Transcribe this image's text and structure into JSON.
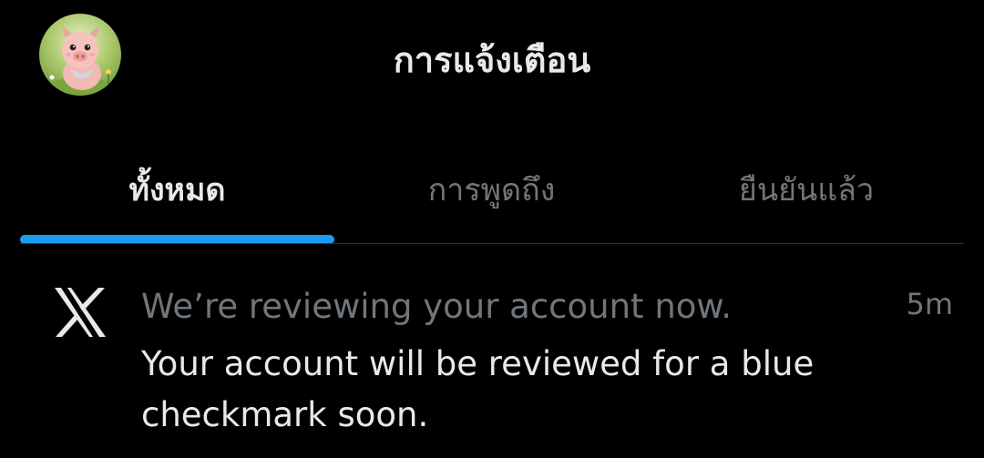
{
  "header": {
    "title": "การแจ้งเตือน",
    "avatar_icon": "pig-avatar-icon"
  },
  "tabs": [
    {
      "label": "ทั้งหมด",
      "active": true
    },
    {
      "label": "การพูดถึง",
      "active": false
    },
    {
      "label": "ยืนยันแล้ว",
      "active": false
    }
  ],
  "notifications": [
    {
      "icon": "x-logo-icon",
      "headline": "We’re reviewing your account now.",
      "time": "5m",
      "body": "Your account will be reviewed for a blue checkmark soon."
    }
  ],
  "colors": {
    "background": "#000000",
    "accent": "#1d9bf0",
    "primary_text": "#e7e9ea",
    "secondary_text": "#71767b",
    "divider": "#2f3336"
  }
}
